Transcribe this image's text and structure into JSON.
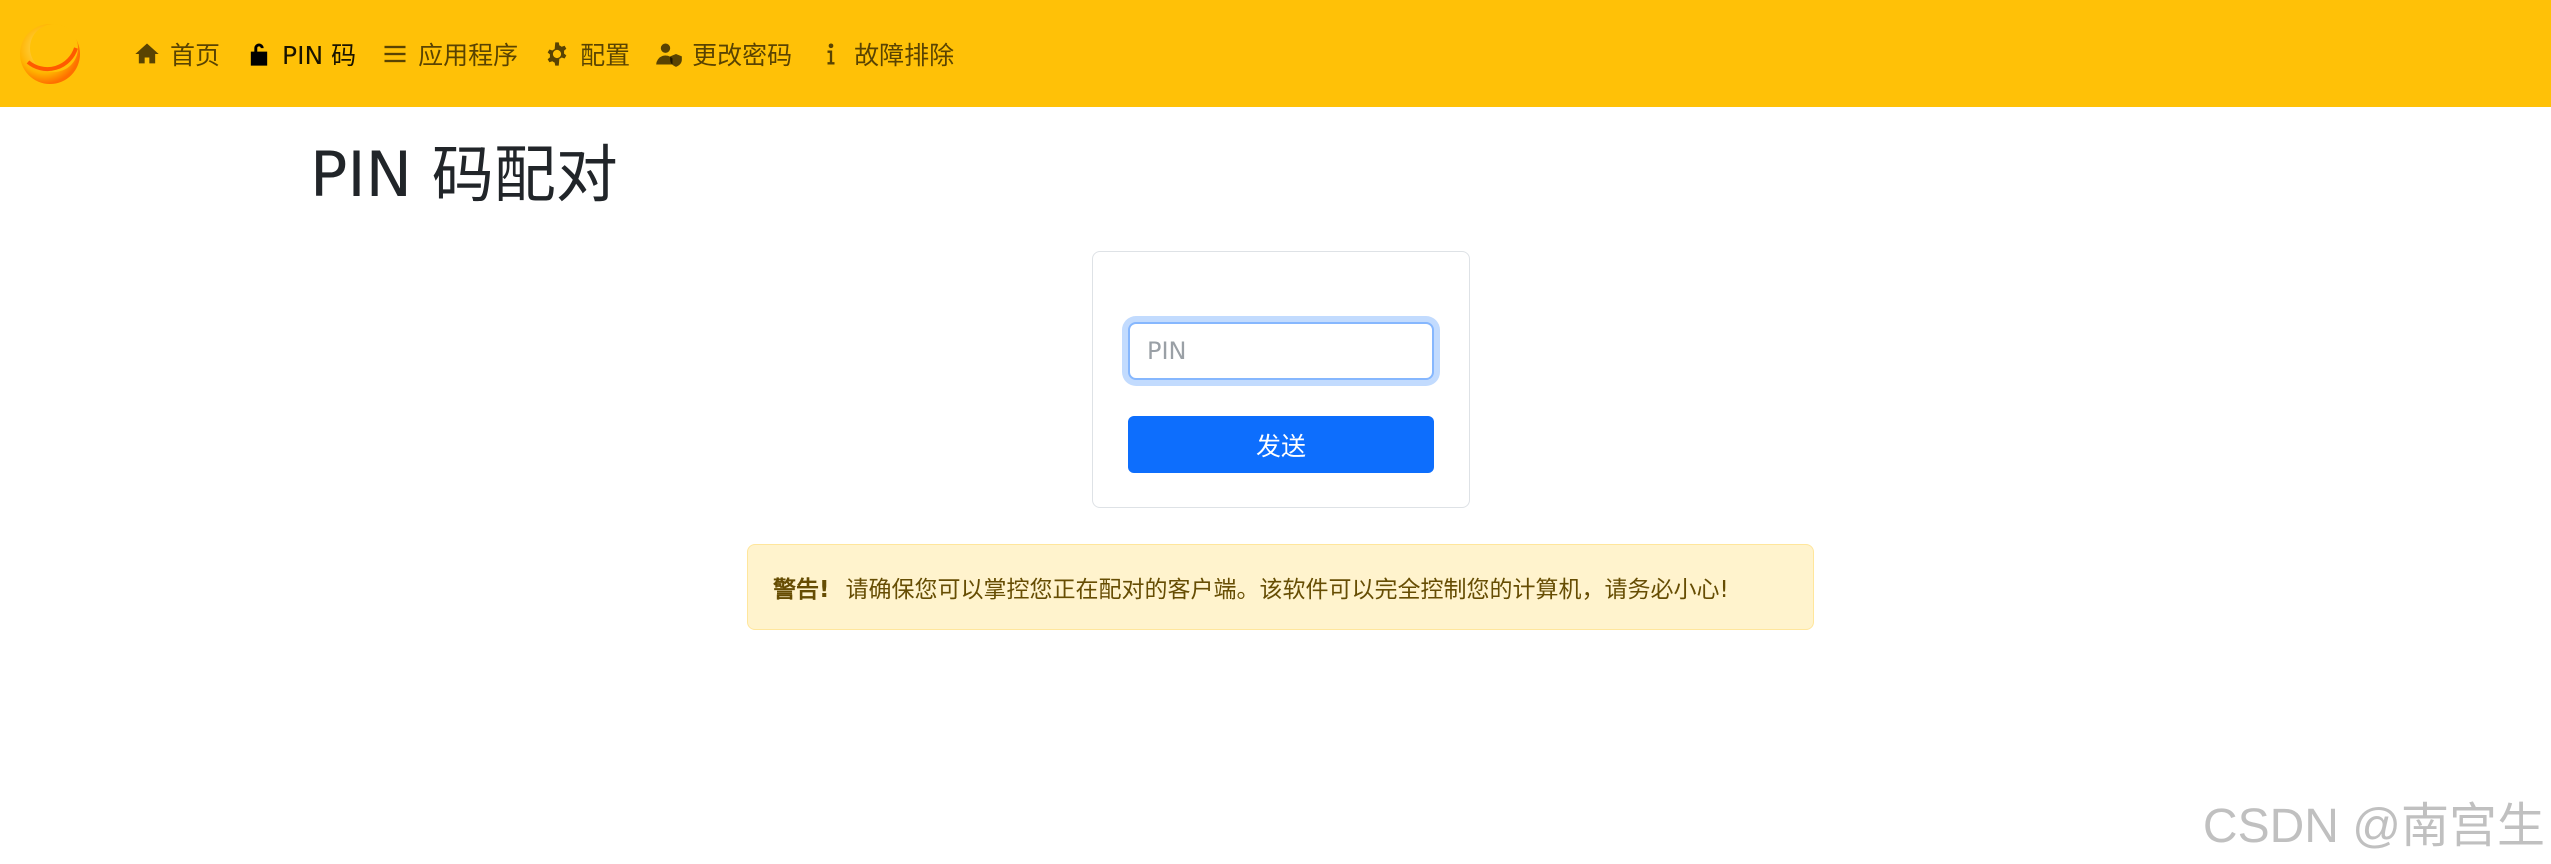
{
  "colors": {
    "navbar_bg": "#ffc107",
    "primary": "#0d6efd",
    "warning_bg": "#fff3cd",
    "warning_text": "#664d03"
  },
  "nav": {
    "items": [
      {
        "label": "首页",
        "icon": "home-icon"
      },
      {
        "label": "PIN 码",
        "icon": "unlock-icon",
        "active": true
      },
      {
        "label": "应用程序",
        "icon": "list-icon"
      },
      {
        "label": "配置",
        "icon": "gear-icon"
      },
      {
        "label": "更改密码",
        "icon": "user-shield-icon"
      },
      {
        "label": "故障排除",
        "icon": "info-icon"
      }
    ]
  },
  "page": {
    "title": "PIN 码配对"
  },
  "form": {
    "pin_placeholder": "PIN",
    "pin_value": "",
    "send_label": "发送"
  },
  "alert": {
    "strong": "警告!",
    "message": "请确保您可以掌控您正在配对的客户端。该软件可以完全控制您的计算机，请务必小心!"
  },
  "watermark": "CSDN @南宫生"
}
